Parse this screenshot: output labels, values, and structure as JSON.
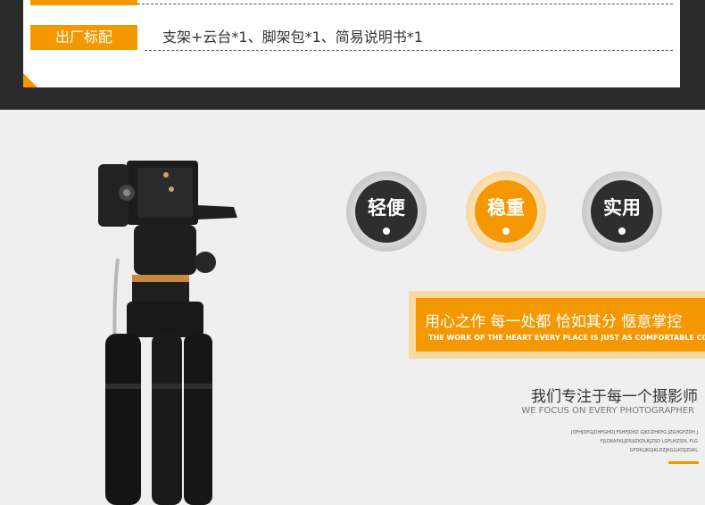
{
  "spec": {
    "label": "出厂标配",
    "value": "支架+云台*1、脚架包*1、简易说明书*1"
  },
  "features": [
    {
      "label": "轻便",
      "style": "dark"
    },
    {
      "label": "稳重",
      "style": "orange"
    },
    {
      "label": "实用",
      "style": "dark"
    }
  ],
  "slogan": {
    "title": "用心之作 每一处都 恰如其分 惬意掌控",
    "subtitle": "THE WORK OF THE HEART EVERY PLACE IS JUST AS COMFORTABLE CONTROL"
  },
  "focus": {
    "title": "我们专注于每一个摄影师",
    "subtitle": "WE FOCUS ON EVERY PHOTOGRAPHER",
    "filler_lines": [
      "JOFHJDFGJDHFGHDJ FSHFJDHZ GJKDZHKFG JZGHGFZDH J",
      "FJLDKAFKLJDSAZKDLKJZSD LGFLHZSDL FLG",
      "GFDKLJKGJKLDZJKGLLKDJZGKL"
    ]
  },
  "colors": {
    "accent": "#f39800",
    "dark": "#2b2b2b",
    "background": "#efefef"
  }
}
